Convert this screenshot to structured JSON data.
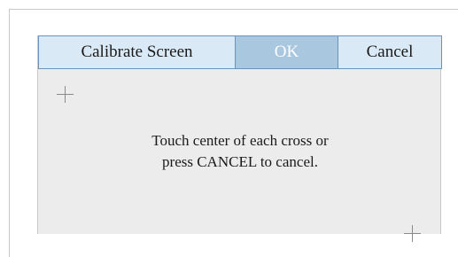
{
  "toolbar": {
    "title": "Calibrate Screen",
    "ok_label": "OK",
    "cancel_label": "Cancel"
  },
  "instructions": {
    "line1": "Touch center of each cross or",
    "line2": "press CANCEL to cancel."
  },
  "calibration_targets": [
    {
      "icon": "crosshair-icon",
      "position": "top-left"
    },
    {
      "icon": "crosshair-icon",
      "position": "bottom-right"
    }
  ],
  "colors": {
    "toolbar_bg": "#d9e9f5",
    "ok_bg": "#a9c7df",
    "toolbar_border": "#6b94b8",
    "panel_bg": "#ececec"
  }
}
